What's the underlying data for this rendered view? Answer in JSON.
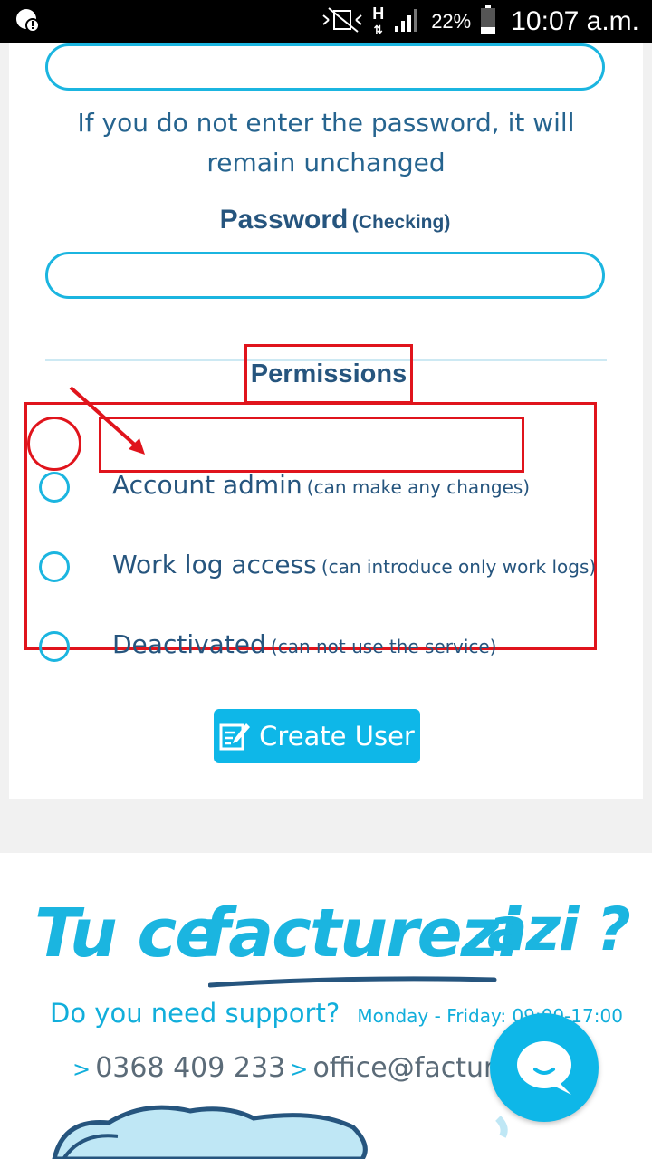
{
  "status_bar": {
    "battery_percent": "22%",
    "time": "10:07 a.m.",
    "network_label": "H"
  },
  "form": {
    "password_hint": "If you do not enter the password, it will remain unchanged",
    "password_check_label": "Password",
    "password_check_sub": "(Checking)",
    "permissions_title": "Permissions",
    "options": [
      {
        "label": "Account admin",
        "desc": "(can make any changes)"
      },
      {
        "label": "Work log access",
        "desc": "(can introduce only work logs)"
      },
      {
        "label": "Deactivated",
        "desc": "(can not use the service)"
      }
    ],
    "create_button": "Create User"
  },
  "footer": {
    "slogan_1": "Tu ce",
    "slogan_2": "facturezi",
    "slogan_3": "azi ?",
    "support_question": "Do you need support?",
    "hours": "Monday - Friday: 09:00-17:00",
    "phone": "0368 409 233",
    "email": "office@factur"
  },
  "colors": {
    "accent": "#1bb5e0",
    "button": "#0eb7e8",
    "text_dark": "#26557e",
    "highlight": "#e0141c"
  }
}
